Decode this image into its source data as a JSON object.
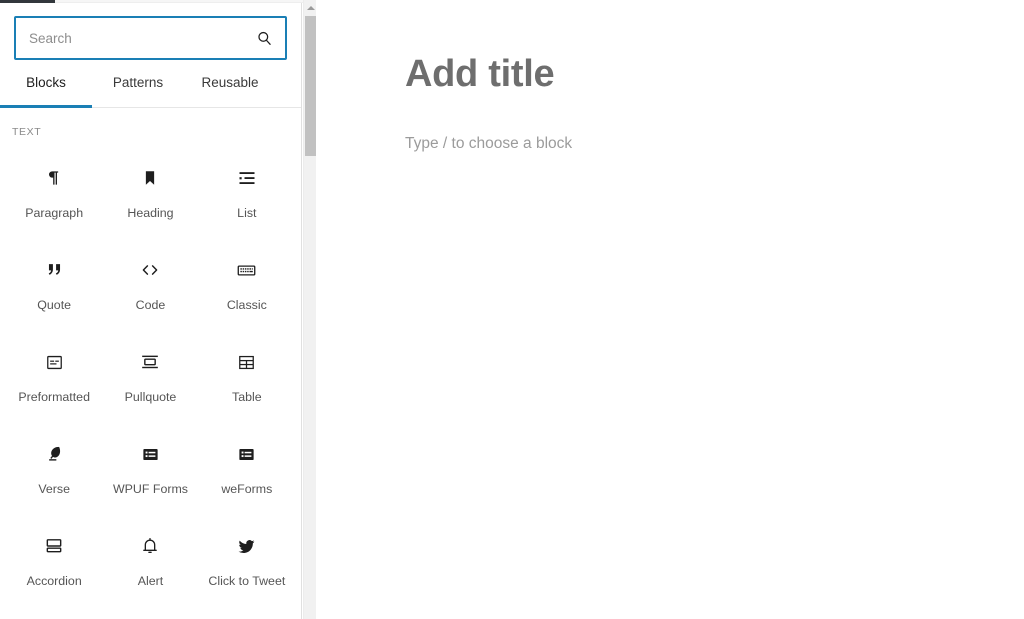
{
  "inserter": {
    "search": {
      "placeholder": "Search",
      "value": "",
      "icon": "search-icon"
    },
    "tabs": [
      {
        "label": "Blocks",
        "active": true
      },
      {
        "label": "Patterns",
        "active": false
      },
      {
        "label": "Reusable",
        "active": false
      }
    ],
    "categories": [
      {
        "label": "TEXT",
        "blocks": [
          {
            "label": "Paragraph",
            "icon": "pilcrow-icon"
          },
          {
            "label": "Heading",
            "icon": "bookmark-icon"
          },
          {
            "label": "List",
            "icon": "bulleted-list-icon"
          },
          {
            "label": "Quote",
            "icon": "quotation-mark-icon"
          },
          {
            "label": "Code",
            "icon": "angle-brackets-icon"
          },
          {
            "label": "Classic",
            "icon": "keyboard-icon"
          },
          {
            "label": "Preformatted",
            "icon": "preformatted-box-icon"
          },
          {
            "label": "Pullquote",
            "icon": "pullquote-icon"
          },
          {
            "label": "Table",
            "icon": "table-grid-icon"
          },
          {
            "label": "Verse",
            "icon": "quill-pen-icon"
          },
          {
            "label": "WPUF Forms",
            "icon": "form-list-icon"
          },
          {
            "label": "weForms",
            "icon": "form-list-icon"
          },
          {
            "label": "Accordion",
            "icon": "stacked-panels-icon"
          },
          {
            "label": "Alert",
            "icon": "bell-icon"
          },
          {
            "label": "Click to Tweet",
            "icon": "twitter-bird-icon"
          }
        ]
      }
    ],
    "scrollbar": {
      "up_arrow_icon": "chevron-up-icon"
    }
  },
  "editor": {
    "title_placeholder": "Add title",
    "body_placeholder": "Type / to choose a block"
  },
  "colors": {
    "accent": "#1a7fb5",
    "admin_bar": "#32373c",
    "title_text": "#6e6e6e",
    "placeholder_text": "#9b9b9b",
    "label_text": "#555555",
    "scroll_thumb": "#c1c1c1"
  }
}
